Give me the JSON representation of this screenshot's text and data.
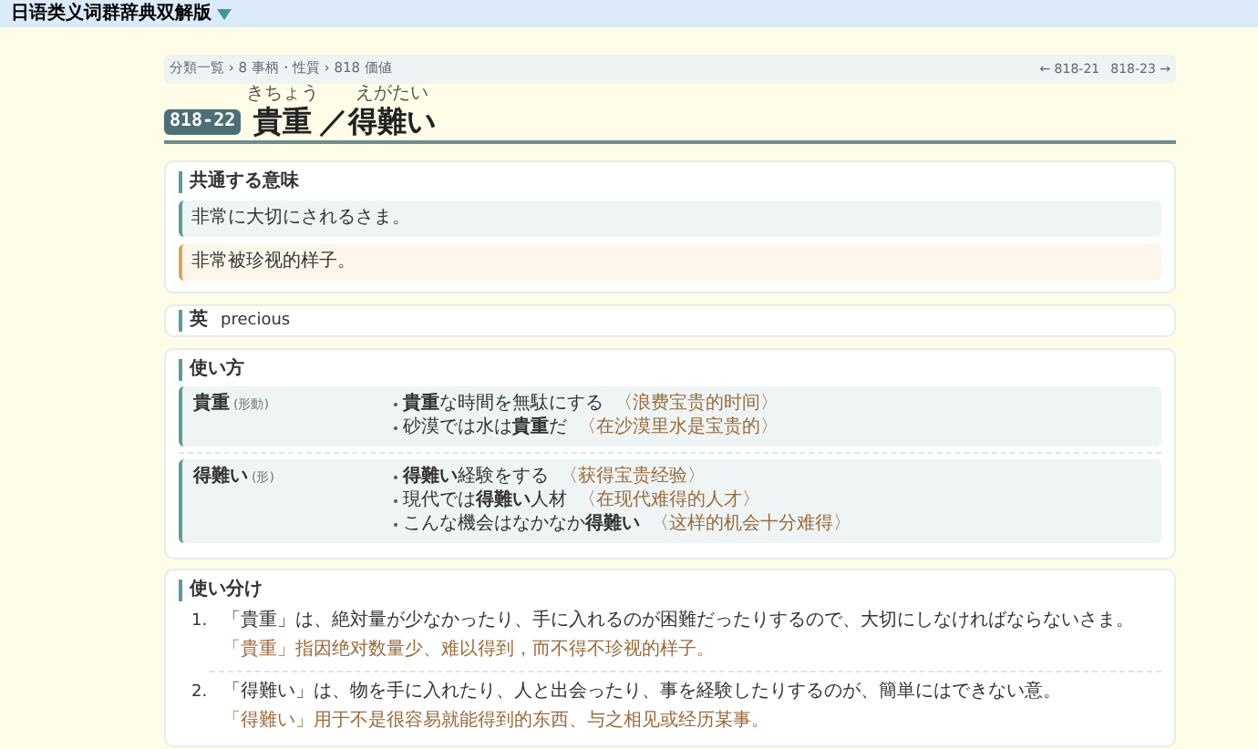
{
  "top_bar": {
    "title": "日语类义词群辞典双解版"
  },
  "breadcrumb": {
    "path": "分類一覧 › 8 事柄・性質 › 818 価値",
    "prev": "← 818-21",
    "next": "818-23 →"
  },
  "entry": {
    "code": "818-22",
    "title_parts": [
      {
        "text": "貴重",
        "reading": "きちょう"
      },
      {
        "text": "／"
      },
      {
        "text": "得難い",
        "reading": "えがたい"
      }
    ]
  },
  "common_meaning": {
    "heading": "共通する意味",
    "japanese": "非常に大切にされるさま。",
    "chinese": "非常被珍视的样子。"
  },
  "english": {
    "label": "英",
    "word": "precious"
  },
  "usage": {
    "heading": "使い方",
    "words": [
      {
        "word": "貴重",
        "pos": "(形動)",
        "examples": [
          {
            "text": "**貴重**な時間を無駄にする",
            "translation": "〈浪费宝贵的时间〉"
          },
          {
            "text": "砂漠では水は**貴重**だ",
            "translation": "〈在沙漠里水是宝贵的〉"
          }
        ]
      },
      {
        "word": "得難い",
        "pos": "(形)",
        "examples": [
          {
            "text": "**得難い**経験をする",
            "translation": "〈获得宝贵经验〉"
          },
          {
            "text": "現代では**得難い**人材",
            "translation": "〈在现代难得的人才〉"
          },
          {
            "text": "こんな機会はなかなか**得難い**",
            "translation": "〈这样的机会十分难得〉"
          }
        ]
      }
    ]
  },
  "distinction": {
    "heading": "使い分け",
    "items": [
      {
        "number": "1.",
        "japanese": "「貴重」は、絶対量が少なかったり、手に入れるのが困難だったりするので、大切にしなければならないさま。",
        "chinese": "「貴重」指因绝对数量少、难以得到，而不得不珍视的样子。"
      },
      {
        "number": "2.",
        "japanese": "「得難い」は、物を手に入れたり、人と出会ったり、事を経験したりするのが、簡単にはできない意。",
        "chinese": "「得難い」用于不是很容易就能得到的东西、与之相见或经历某事。"
      }
    ]
  }
}
